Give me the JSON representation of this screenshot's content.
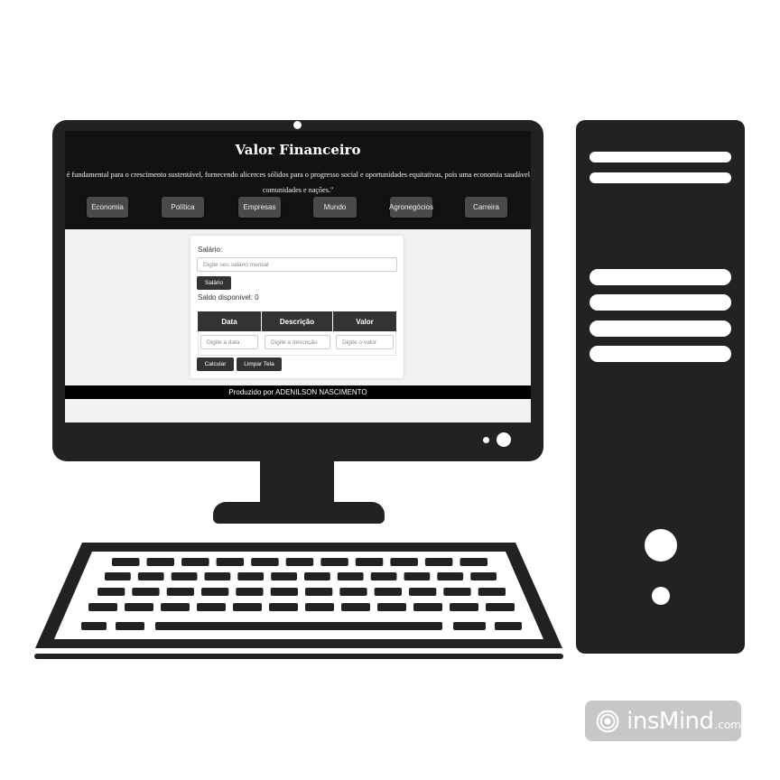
{
  "site": {
    "title": "Valor Financeiro",
    "quote_line1": "ica é fundamental para o crescimento sustentável, fornecendo alicerces sólidos para o progresso social e oportunidades equitativas, pois uma economia saudável im",
    "quote_line2": "comunidades e nações.\"",
    "nav": [
      "Economia",
      "Política",
      "Empresas",
      "Mundo",
      "Agronegócios",
      "Carreira"
    ],
    "form": {
      "salary_label": "Salário:",
      "salary_placeholder": "Digite seu salário mensal",
      "salary_button": "Salário",
      "balance_label": "Saldo disponível: 0",
      "table_headers": [
        "Data",
        "Descrição",
        "Valor"
      ],
      "date_placeholder": "Digite a data",
      "description_placeholder": "Digite a descrição",
      "value_placeholder": "Digite o valor",
      "calculate_button": "Calcular",
      "clear_button": "Limpar Tela"
    },
    "footer": "Produzido por ADENILSON NASCIMENTO"
  },
  "watermark": {
    "brand": "insMind",
    "suffix": ".com"
  },
  "colors": {
    "device": "#222222",
    "header_bg": "#121212",
    "nav_button": "#4a4a4a",
    "dark_button": "#333333"
  }
}
